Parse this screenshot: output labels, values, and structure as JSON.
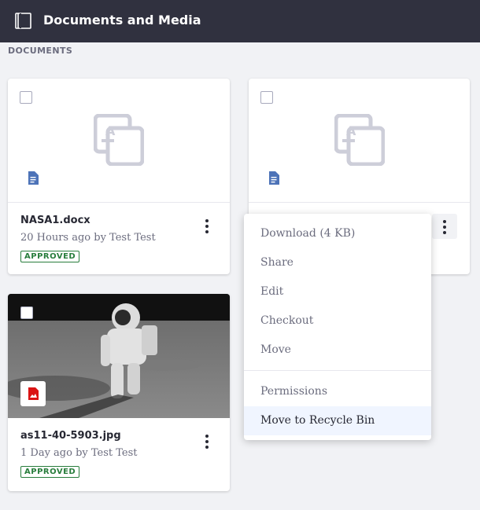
{
  "header": {
    "title": "Documents and Media"
  },
  "section": {
    "label": "DOCUMENTS"
  },
  "cards": [
    {
      "file_name": "NASA1.docx",
      "meta": "20 Hours ago by Test Test",
      "status": "APPROVED"
    },
    {
      "file_name": "",
      "meta": "",
      "status": ""
    },
    {
      "file_name": "as11-40-5903.jpg",
      "meta": "1 Day ago by Test Test",
      "status": "APPROVED"
    }
  ],
  "menu": {
    "items": [
      {
        "label": "Download (4 KB)"
      },
      {
        "label": "Share"
      },
      {
        "label": "Edit"
      },
      {
        "label": "Checkout"
      },
      {
        "label": "Move"
      },
      {
        "label": "Permissions"
      },
      {
        "label": "Move to Recycle Bin"
      }
    ]
  },
  "colors": {
    "topbar": "#30313f",
    "approved": "#287d3c",
    "doc_icon": "#2e5aac",
    "image_icon": "#da1414",
    "menu_highlight": "#f0f5ff"
  }
}
